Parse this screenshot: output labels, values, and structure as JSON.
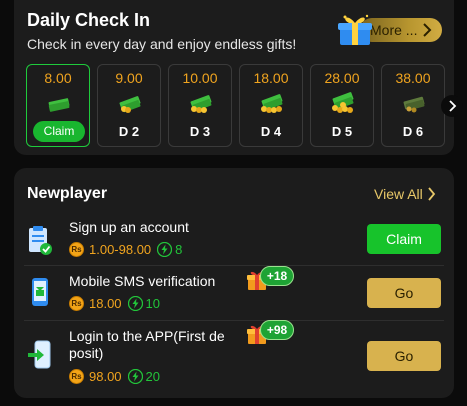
{
  "daily": {
    "title": "Daily Check In",
    "subtitle": "Check in every day and enjoy endless gifts!",
    "more_label": "More ...",
    "days": [
      {
        "amount": "8.00",
        "label": "Claim",
        "claimable": true
      },
      {
        "amount": "9.00",
        "label": "D 2",
        "claimable": false
      },
      {
        "amount": "10.00",
        "label": "D 3",
        "claimable": false
      },
      {
        "amount": "18.00",
        "label": "D 4",
        "claimable": false
      },
      {
        "amount": "28.00",
        "label": "D 5",
        "claimable": false
      },
      {
        "amount": "38.00",
        "label": "D 6",
        "claimable": false
      }
    ]
  },
  "newplayer": {
    "title": "Newplayer",
    "view_all": "View All",
    "currency_symbol": "Rs",
    "tasks": [
      {
        "name": "Sign up an account",
        "reward": "1.00-98.00",
        "points": "8",
        "button": "Claim",
        "bonus": ""
      },
      {
        "name": "Mobile SMS verification",
        "reward": "18.00",
        "points": "10",
        "button": "Go",
        "bonus": "+18"
      },
      {
        "name_line1": "Login to the APP(First de",
        "name_line2": "posit)",
        "reward": "98.00",
        "points": "20",
        "button": "Go",
        "bonus": "+98"
      }
    ]
  },
  "colors": {
    "accent_green": "#17c32b",
    "gold": "#d8b24e",
    "amount_orange": "#f0a41f",
    "card_bg": "#1c1c1c"
  },
  "icons": [
    "gift-box-icon",
    "chevron-right-icon",
    "cash-stack-icon",
    "document-check-icon",
    "phone-sms-icon",
    "phone-login-icon",
    "rupee-coin-icon",
    "lightning-bolt-icon"
  ]
}
